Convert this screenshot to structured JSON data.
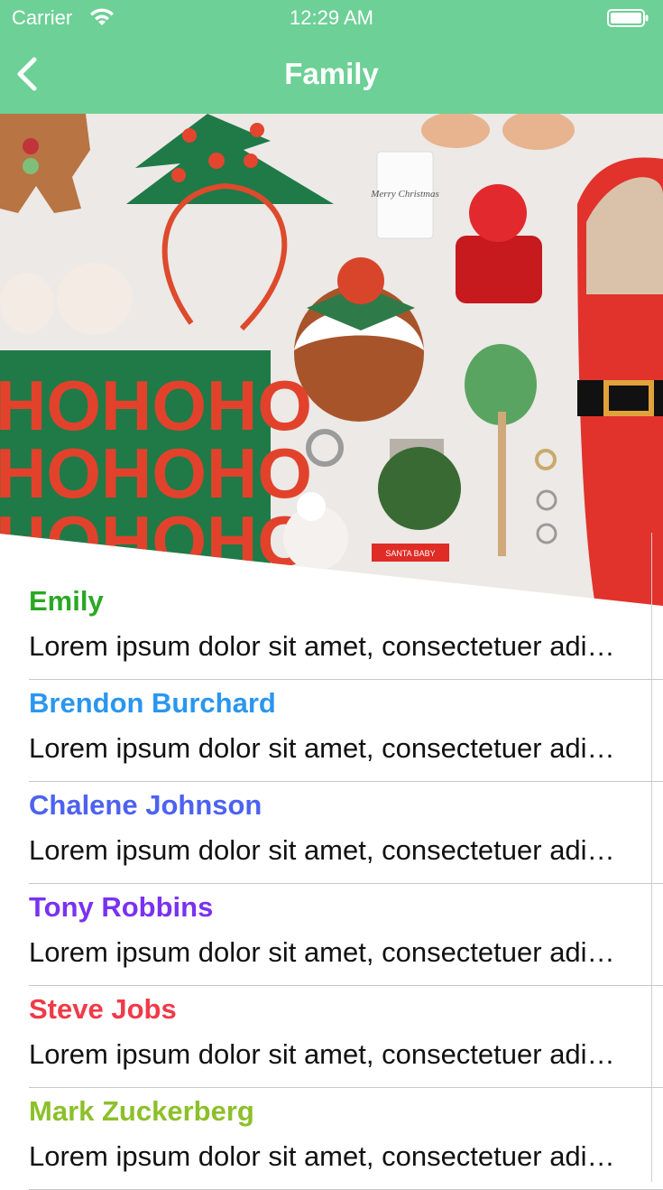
{
  "status_bar": {
    "carrier": "Carrier",
    "time": "12:29 AM",
    "wifi_icon": "wifi-icon",
    "battery_icon": "battery-icon"
  },
  "nav": {
    "title": "Family",
    "back_icon": "chevron-left-icon",
    "background_color": "#6dd096"
  },
  "hero": {
    "image": "christmas-flatlay-photo",
    "tag_text": "Merry Christmas",
    "pouch_text": "HOHOHO",
    "lipbalm_text": "SANTA BABY"
  },
  "contacts": [
    {
      "name": "Emily",
      "color": "#2aa824",
      "text": "Lorem ipsum dolor sit amet, consectetuer adipiscing elit"
    },
    {
      "name": "Brendon Burchard",
      "color": "#2a96ef",
      "text": "Lorem ipsum dolor sit amet, consectetuer adipiscing elit"
    },
    {
      "name": "Chalene Johnson",
      "color": "#4d62f0",
      "text": "Lorem ipsum dolor sit amet, consectetuer adipiscing elit"
    },
    {
      "name": "Tony Robbins",
      "color": "#7a32f0",
      "text": "Lorem ipsum dolor sit amet, consectetuer adipiscing elit"
    },
    {
      "name": "Steve Jobs",
      "color": "#f03a48",
      "text": "Lorem ipsum dolor sit amet, consectetuer adipiscing elit"
    },
    {
      "name": "Mark Zuckerberg",
      "color": "#8cc02a",
      "text": "Lorem ipsum dolor sit amet, consectetuer adipiscing elit"
    }
  ]
}
